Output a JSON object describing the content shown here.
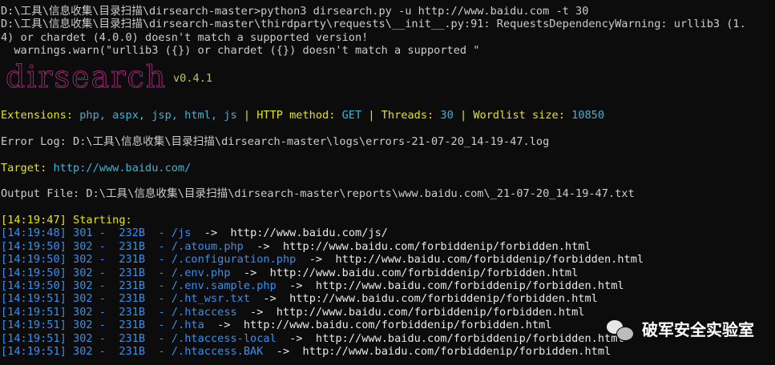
{
  "console": {
    "cmd_line": "D:\\工具\\信息收集\\目录扫描\\dirsearch-master>python3 dirsearch.py -u http://www.baidu.com -t 30",
    "warn_line1": "D:\\工具\\信息收集\\目录扫描\\dirsearch-master\\thirdparty\\requests\\__init__.py:91: RequestsDependencyWarning: urllib3 (1.",
    "warn_line2": "4) or chardet (4.0.0) doesn't match a supported version!",
    "warn_line3": "  warnings.warn(\"urllib3 ({}) or chardet ({}) doesn't match a supported \""
  },
  "banner": {
    "logo_text": "dirsearch",
    "version": "v0.4.1"
  },
  "config": {
    "extensions_label": "Extensions: ",
    "extensions_value": "php, aspx, jsp, html, js",
    "sep": " | ",
    "method_label": "HTTP method: ",
    "method_value": "GET",
    "threads_label": "Threads: ",
    "threads_value": "30",
    "wordlist_label": "Wordlist size: ",
    "wordlist_value": "10850"
  },
  "error_log": "Error Log: D:\\工具\\信息收集\\目录扫描\\dirsearch-master\\logs\\errors-21-07-20_14-19-47.log",
  "target": {
    "label": "Target: ",
    "value": "http://www.baidu.com/"
  },
  "output_file": "Output File: D:\\工具\\信息收集\\目录扫描\\dirsearch-master\\reports\\www.baidu.com\\_21-07-20_14-19-47.txt",
  "starting": "[14:19:47] Starting: ",
  "results": [
    {
      "time": "[14:19:48]",
      "status": "301",
      "size": "232B",
      "path": "/js",
      "redirect": "http://www.baidu.com/js/"
    },
    {
      "time": "[14:19:50]",
      "status": "302",
      "size": "231B",
      "path": "/.atoum.php",
      "redirect": "http://www.baidu.com/forbiddenip/forbidden.html"
    },
    {
      "time": "[14:19:50]",
      "status": "302",
      "size": "231B",
      "path": "/.configuration.php",
      "redirect": "http://www.baidu.com/forbiddenip/forbidden.html"
    },
    {
      "time": "[14:19:50]",
      "status": "302",
      "size": "231B",
      "path": "/.env.php",
      "redirect": "http://www.baidu.com/forbiddenip/forbidden.html"
    },
    {
      "time": "[14:19:50]",
      "status": "302",
      "size": "231B",
      "path": "/.env.sample.php",
      "redirect": "http://www.baidu.com/forbiddenip/forbidden.html"
    },
    {
      "time": "[14:19:51]",
      "status": "302",
      "size": "231B",
      "path": "/.ht_wsr.txt",
      "redirect": "http://www.baidu.com/forbiddenip/forbidden.html"
    },
    {
      "time": "[14:19:51]",
      "status": "302",
      "size": "231B",
      "path": "/.htaccess",
      "redirect": "http://www.baidu.com/forbiddenip/forbidden.html"
    },
    {
      "time": "[14:19:51]",
      "status": "302",
      "size": "231B",
      "path": "/.hta",
      "redirect": "http://www.baidu.com/forbiddenip/forbidden.html"
    },
    {
      "time": "[14:19:51]",
      "status": "302",
      "size": "231B",
      "path": "/.htaccess-local",
      "redirect": "http://www.baidu.com/forbiddenip/forbidden.html"
    },
    {
      "time": "[14:19:51]",
      "status": "302",
      "size": "231B",
      "path": "/.htaccess.BAK",
      "redirect": "http://www.baidu.com/forbiddenip/forbidden.html"
    }
  ],
  "result_fmt": {
    "dash": " -  ",
    "path_sep": "  - ",
    "arrow": "  ->  "
  },
  "watermark": {
    "text": "破军安全实验室",
    "icon": "wechat-icon"
  }
}
